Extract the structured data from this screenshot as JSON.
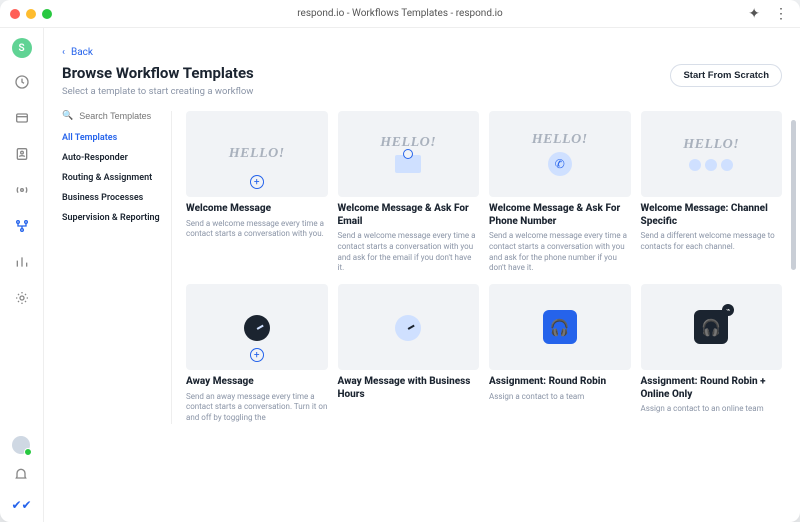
{
  "titlebar": {
    "title": "respond.io - Workflows Templates - respond.io",
    "logo_letter": "S"
  },
  "rail": {
    "items": [
      {
        "name": "dashboard-icon"
      },
      {
        "name": "inbox-icon"
      },
      {
        "name": "contacts-icon"
      },
      {
        "name": "broadcast-icon"
      },
      {
        "name": "workflows-icon",
        "active": true
      },
      {
        "name": "reports-icon"
      },
      {
        "name": "settings-icon"
      }
    ]
  },
  "back_label": "Back",
  "header": {
    "title": "Browse Workflow Templates",
    "subtitle": "Select a template to start creating a workflow"
  },
  "scratch_button": "Start From Scratch",
  "search": {
    "placeholder": "Search Templates"
  },
  "categories": [
    {
      "label": "All Templates",
      "active": true
    },
    {
      "label": "Auto-Responder"
    },
    {
      "label": "Routing & Assignment"
    },
    {
      "label": "Business Processes"
    },
    {
      "label": "Supervision & Reporting"
    }
  ],
  "templates": [
    {
      "title": "Welcome Message",
      "desc": "Send a welcome message every time a contact starts a conversation with you.",
      "thumb": "hello-plain"
    },
    {
      "title": "Welcome Message & Ask For Email",
      "desc": "Send a welcome message every time a contact starts a conversation with you and ask for the email if you don't have it.",
      "thumb": "hello-email"
    },
    {
      "title": "Welcome Message & Ask For Phone Number",
      "desc": "Send a welcome message every time a contact starts a conversation with you and ask for the phone number if you don't have it.",
      "thumb": "hello-phone"
    },
    {
      "title": "Welcome Message: Channel Specific",
      "desc": "Send a different welcome message to contacts for each channel.",
      "thumb": "hello-dots"
    },
    {
      "title": "Away Message",
      "desc": "Send an away message every time a contact starts a conversation. Turn it on and off by toggling the",
      "thumb": "clock-dark"
    },
    {
      "title": "Away Message with Business Hours",
      "desc": "",
      "thumb": "clock-blue"
    },
    {
      "title": "Assignment: Round Robin",
      "desc": "Assign a contact to a team",
      "thumb": "person-blue"
    },
    {
      "title": "Assignment: Round Robin + Online Only",
      "desc": "Assign a contact to an online team",
      "thumb": "person-dark"
    }
  ]
}
